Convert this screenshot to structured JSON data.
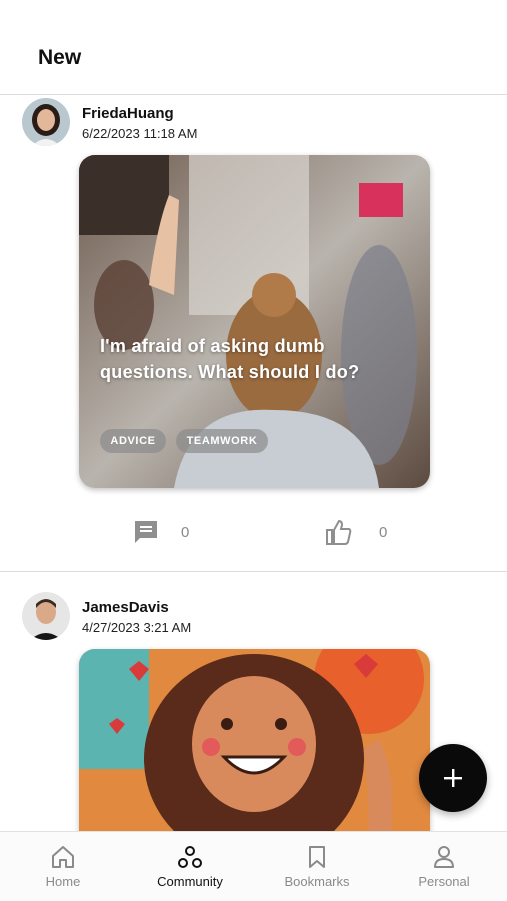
{
  "header": {
    "title": "New"
  },
  "posts": [
    {
      "author": "FriedaHuang",
      "date": "6/22/2023 11:18 AM",
      "card_text": "I'm afraid of asking dumb questions. What should I do?",
      "tags": [
        "ADVICE",
        "TEAMWORK"
      ],
      "comments": "0",
      "likes": "0"
    },
    {
      "author": "JamesDavis",
      "date": "4/27/2023 3:21 AM"
    }
  ],
  "tabs": [
    {
      "label": "Home",
      "icon": "home-icon"
    },
    {
      "label": "Community",
      "icon": "community-icon",
      "active": true
    },
    {
      "label": "Bookmarks",
      "icon": "bookmark-icon"
    },
    {
      "label": "Personal",
      "icon": "person-icon"
    }
  ],
  "fab": {
    "icon": "plus-icon"
  },
  "colors": {
    "accent": "#111111",
    "muted": "#8a8a8a",
    "tag_bg": "#8c8c8c"
  }
}
